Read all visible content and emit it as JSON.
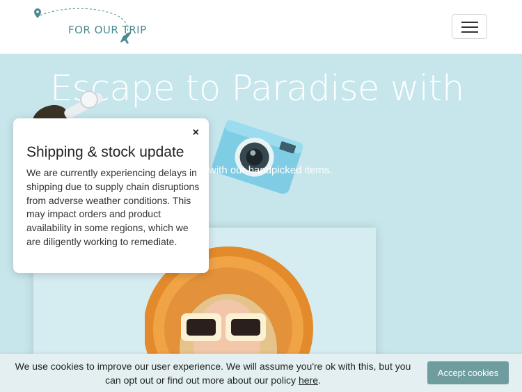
{
  "header": {
    "logo_text": "FOR OUR TRIP",
    "menu_icon": "hamburger-icon"
  },
  "hero": {
    "title": "Escape to Paradise with",
    "subtitle": "with our handpicked items."
  },
  "popup": {
    "close_label": "×",
    "title": "Shipping & stock update",
    "body": "We are currently experiencing delays in shipping due to supply chain disruptions from adverse weather conditions. This may impact orders and product availability in some regions, which we are diligently working to remediate."
  },
  "cookie_bar": {
    "text": "We use cookies to improve our user experience. We will assume you're ok with this, but you can opt out or find out more about our policy",
    "link_label": "here",
    "period": ".",
    "accept_label": "Accept cookies"
  },
  "colors": {
    "hero_background": "#c7e6ec",
    "accent": "#6f9c9d",
    "logo": "#4d8a8f"
  }
}
